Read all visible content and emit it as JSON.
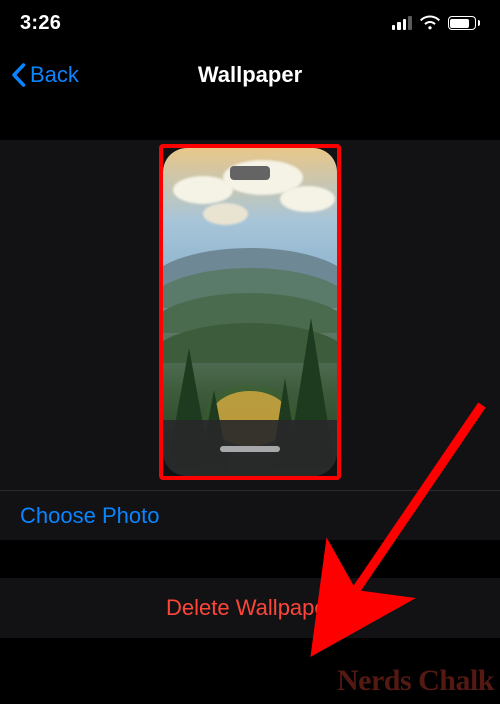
{
  "status": {
    "time": "3:26",
    "cellular_bars_active": 3,
    "cellular_bars_total": 4,
    "wifi": true,
    "battery_fill_percent": 80
  },
  "nav": {
    "back_label": "Back",
    "title": "Wallpaper"
  },
  "actions": {
    "choose_photo": "Choose Photo",
    "delete_wallpaper": "Delete Wallpaper"
  },
  "annotation": {
    "highlight_color": "#ff0000",
    "arrow_color": "#ff0000"
  },
  "watermark": "Nerds Chalk",
  "colors": {
    "ios_blue": "#0a84ff",
    "ios_red": "#ff453a",
    "section_bg": "#121214"
  }
}
